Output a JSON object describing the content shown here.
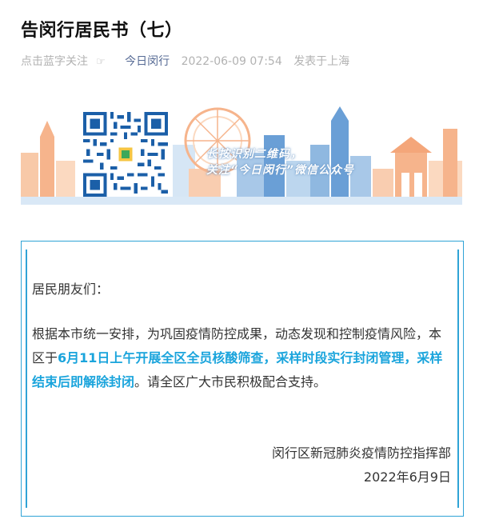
{
  "article": {
    "title": "告闵行居民书（七）",
    "meta": {
      "follow_hint": "点击蓝字关注",
      "follow_icon": "pointing-hand-icon",
      "account": "今日闵行",
      "datetime": "2022-06-09 07:54",
      "location": "发表于上海"
    }
  },
  "banner": {
    "line1": "长按识别二维码，",
    "line2": "关注“今日闵行”微信公众号",
    "colors": {
      "sky_blue": "#bcd6ee",
      "deep_blue": "#6a9fd6",
      "orange": "#f6b48c"
    }
  },
  "notice": {
    "greeting": "居民朋友们：",
    "para_before": "根据本市统一安排，为巩固疫情防控成果，动态发现和控制疫情风险，本区于",
    "para_highlight": "6月11日上午开展全区全员核酸筛查，采样时段实行封闭管理，采样结束后即解除封闭",
    "para_after": "。请全区广大市民积极配合支持。",
    "signature": "闵行区新冠肺炎疫情防控指挥部",
    "date": "2022年6月9日",
    "highlight_color": "#1aa4dc",
    "border_color": "#2fa3d6"
  }
}
